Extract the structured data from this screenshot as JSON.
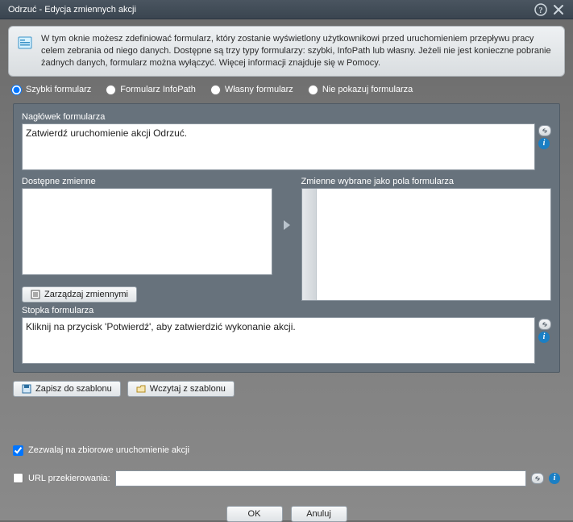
{
  "titlebar": {
    "title": "Odrzuć - Edycja zmiennych akcji"
  },
  "info": {
    "text": "W tym oknie możesz zdefiniować formularz, który zostanie wyświetlony użytkownikowi przed uruchomieniem przepływu pracy celem zebrania od niego danych. Dostępne są trzy typy formularzy: szybki, InfoPath lub  własny. Jeżeli nie jest konieczne pobranie żadnych danych, formularz można wyłączyć. Więcej informacji znajduje się w Pomocy."
  },
  "formType": {
    "quick": "Szybki formularz",
    "infopath": "Formularz InfoPath",
    "custom": "Własny formularz",
    "none": "Nie pokazuj formularza",
    "selected": "quick"
  },
  "labels": {
    "header": "Nagłówek formularza",
    "available": "Dostępne zmienne",
    "selected": "Zmienne wybrane jako pola formularza",
    "footer": "Stopka formularza"
  },
  "headerText": "Zatwierdź uruchomienie akcji Odrzuć.",
  "footerText": "Kliknij na przycisk 'Potwierdź', aby zatwierdzić wykonanie akcji.",
  "buttons": {
    "manageVars": "Zarządzaj zmiennymi",
    "saveTemplate": "Zapisz do szablonu",
    "loadTemplate": "Wczytaj z szablonu",
    "ok": "OK",
    "cancel": "Anuluj"
  },
  "checkbox": {
    "allowBulk": "Zezwalaj na zbiorowe uruchomienie akcji",
    "allowBulkChecked": true,
    "redirectUrl": "URL przekierowania:",
    "redirectUrlChecked": false
  },
  "urlValue": ""
}
